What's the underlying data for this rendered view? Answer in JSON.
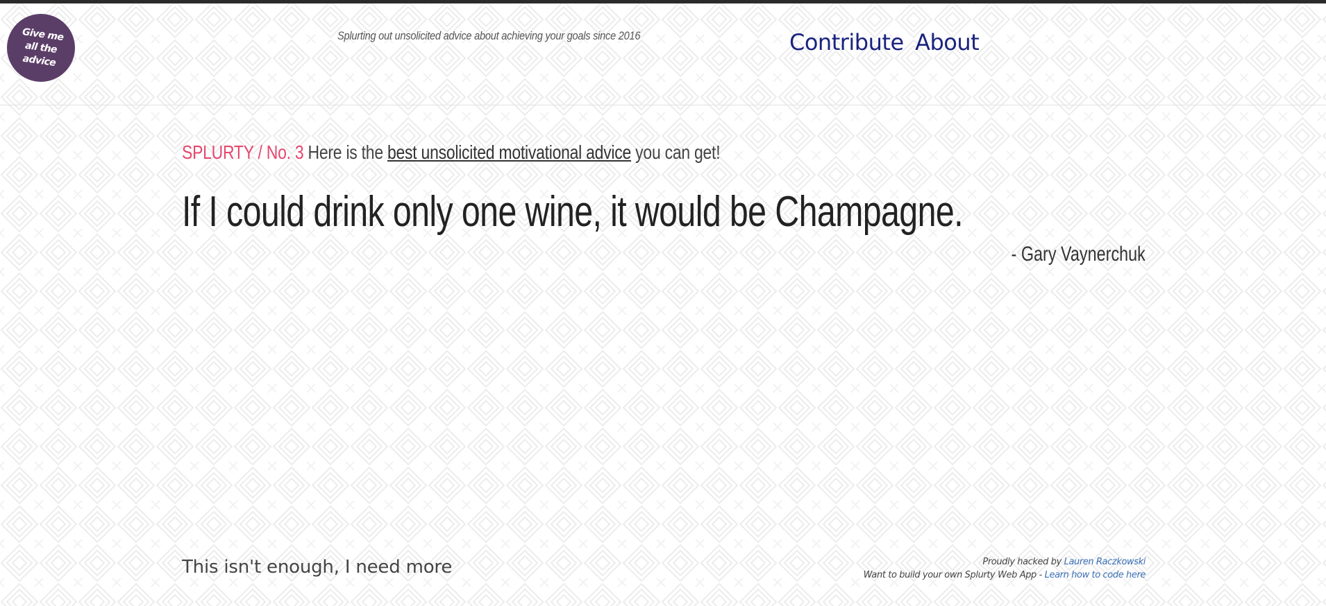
{
  "logo": {
    "lines": [
      "Give me",
      "all the",
      "advice"
    ]
  },
  "header": {
    "tagline": "Splurting out unsolicited advice about achieving your goals since 2016",
    "nav": {
      "contribute": "Contribute",
      "about": "About"
    }
  },
  "splurt": {
    "issue_label": "SPLURTY / No. 3",
    "intro_before": "Here is the",
    "intro_link": "best unsolicited motivational advice",
    "intro_after": "you can get!",
    "quote": "If I could drink only one wine, it would be Champagne.",
    "author": "- Gary Vaynerchuk"
  },
  "footer": {
    "more_link": "This isn't enough, I need more",
    "credit_prefix": "Proudly hacked by",
    "credit_name": "Lauren Raczkowski",
    "build_prefix": "Want to build your own Splurty Web App -",
    "build_link": "Learn how to code here"
  },
  "colors": {
    "logo_bg": "#5b3e68",
    "nav_link": "#1a237e",
    "issue_accent": "#e6486e",
    "credit_link": "#3a6fb5",
    "top_bar": "#2b2b2b"
  },
  "icons": {
    "background_pattern": "diamond-pattern"
  }
}
